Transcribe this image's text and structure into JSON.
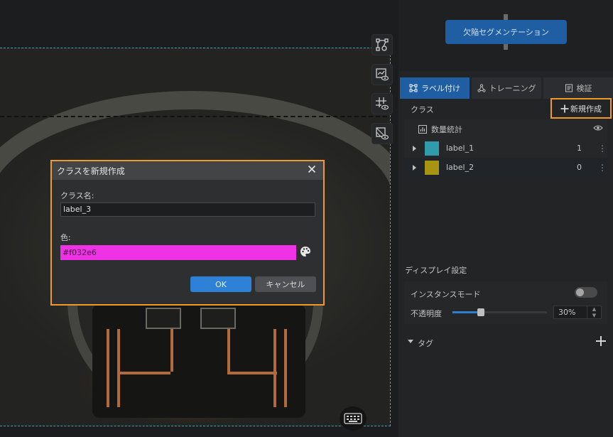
{
  "flow": {
    "node_label": "欠陥セグメンテーション"
  },
  "tabs": [
    {
      "label": "ラベル付け",
      "icon": "label-tool-icon",
      "active": true
    },
    {
      "label": "トレーニング",
      "icon": "training-icon",
      "active": false
    },
    {
      "label": "検証",
      "icon": "validation-icon",
      "active": false
    }
  ],
  "classes": {
    "header": "クラス",
    "new_button": "新規作成",
    "stats_label": "数量統計",
    "items": [
      {
        "name": "label_1",
        "color": "#2f9bab",
        "count": "1"
      },
      {
        "name": "label_2",
        "color": "#a89410",
        "count": "0"
      }
    ]
  },
  "display": {
    "section_label": "ディスプレイ設定",
    "instance_mode_label": "インスタンスモード",
    "instance_mode_on": false,
    "opacity_label": "不透明度",
    "opacity_value": "30%",
    "opacity_fraction": 0.3
  },
  "tags": {
    "label": "タグ"
  },
  "dialog": {
    "title": "クラスを新規作成",
    "name_label": "クラス名:",
    "name_value": "label_3",
    "color_label": "色:",
    "color_value": "#f032e6",
    "ok_label": "OK",
    "cancel_label": "キャンセル"
  },
  "colors": {
    "accent_blue": "#1f5ea3",
    "highlight_orange": "#f19a27",
    "selected_color": "#f032e6"
  }
}
